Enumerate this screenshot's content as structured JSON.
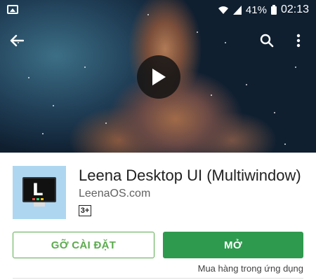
{
  "status_bar": {
    "battery_percent": "41%",
    "time": "02:13",
    "icons": [
      "gallery-icon",
      "wifi-icon",
      "signal-icon",
      "battery-icon"
    ]
  },
  "toolbar": {
    "icons": [
      "back-arrow-icon",
      "search-icon",
      "more-vert-icon"
    ]
  },
  "app": {
    "title": "Leena Desktop UI (Multiwindow)",
    "developer": "LeenaOS.com",
    "content_rating": "3+",
    "icon_letter": "L"
  },
  "actions": {
    "uninstall_label": "GỠ CÀI ĐẶT",
    "open_label": "MỞ",
    "purchase_note": "Mua hàng trong ứng dụng"
  },
  "colors": {
    "primary_green": "#2e9a4e",
    "outline_green": "#5bab4d",
    "app_icon_bg": "#aed6f1"
  }
}
